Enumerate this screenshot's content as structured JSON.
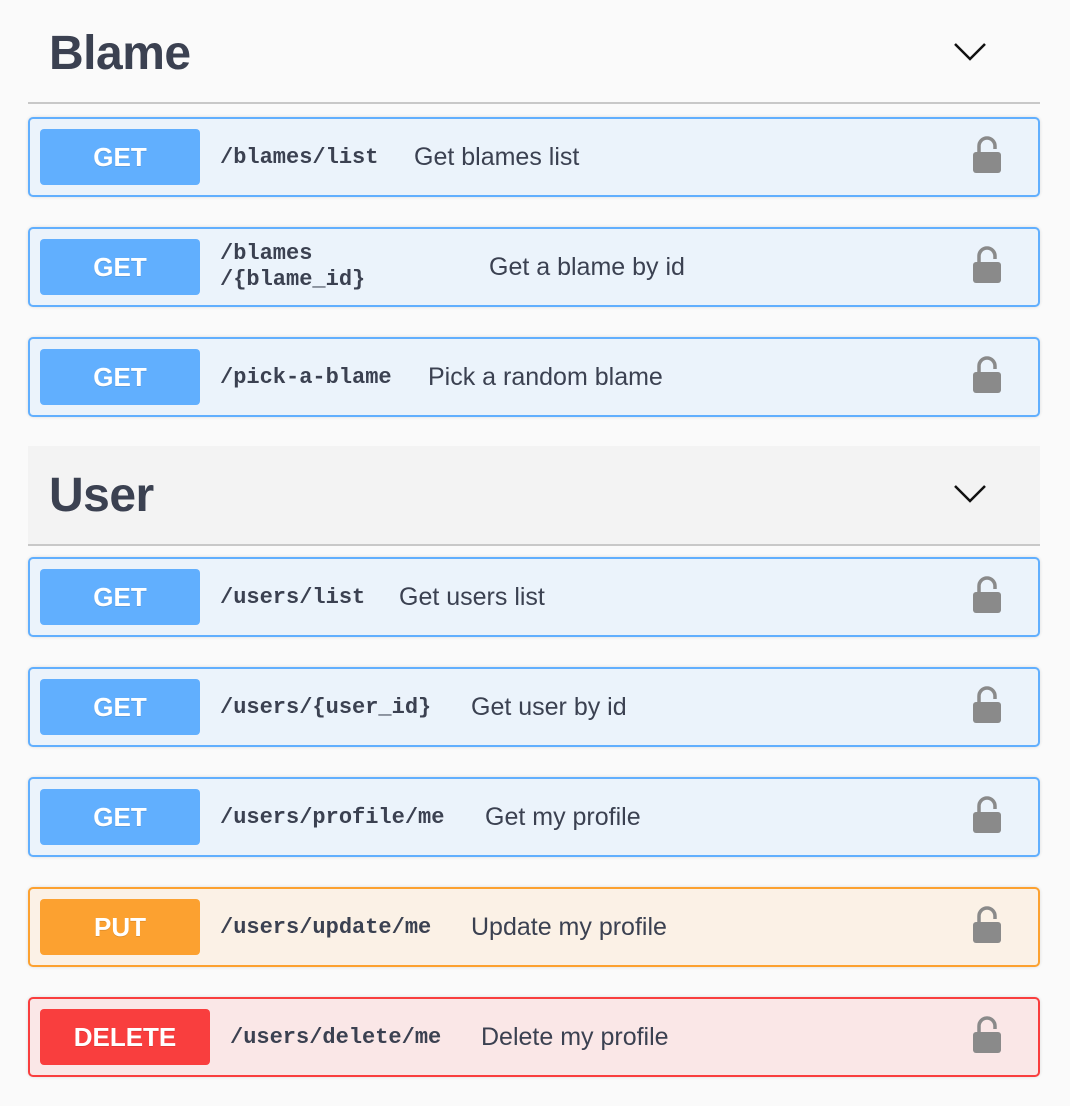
{
  "sections": [
    {
      "title": "Blame",
      "operations": [
        {
          "method": "GET",
          "path": "/blames/list",
          "summary": "Get blames list"
        },
        {
          "method": "GET",
          "path": "/blames /{blame_id}",
          "summary": "Get a blame by id"
        },
        {
          "method": "GET",
          "path": "/pick-a-blame",
          "summary": "Pick a random blame"
        }
      ]
    },
    {
      "title": "User",
      "operations": [
        {
          "method": "GET",
          "path": "/users/list",
          "summary": "Get users list"
        },
        {
          "method": "GET",
          "path": "/users/{user_id}",
          "summary": "Get user by id"
        },
        {
          "method": "GET",
          "path": "/users/profile/me",
          "summary": "Get my profile"
        },
        {
          "method": "PUT",
          "path": "/users/update/me",
          "summary": "Update my profile"
        },
        {
          "method": "DELETE",
          "path": "/users/delete/me",
          "summary": "Delete my profile"
        }
      ]
    }
  ],
  "icons": {
    "collapse": "chevron-down-icon",
    "auth": "lock-icon"
  },
  "colors": {
    "get": "#61affe",
    "put": "#fca130",
    "delete": "#f93e3e",
    "text": "#3b4151",
    "lock": "#8a8a8a"
  }
}
